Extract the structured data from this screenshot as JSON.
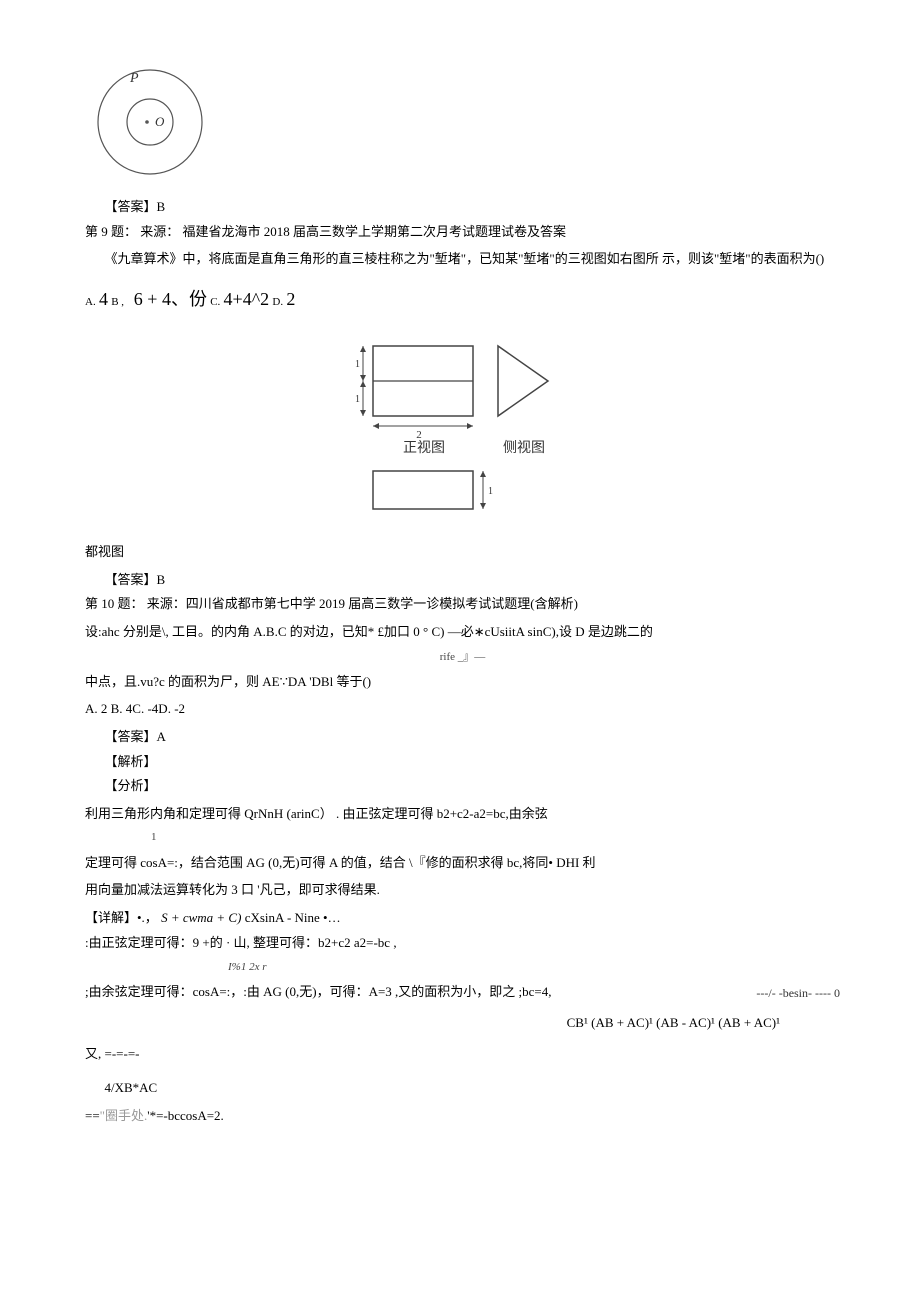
{
  "circle_label_p": "P",
  "circle_label_o": "O",
  "ans8": "【答案】B",
  "q9_head": "第 9 题：  来源： 福建省龙海市 2018 届高三数学上学期第二次月考试题理试卷及答案",
  "q9_body": "《九章算术》中，将底面是直角三角形的直三棱柱称之为\"堑堵\"，已知某\"堑堵\"的三视图如右图所 示，则该\"堑堵\"的表面积为()",
  "q9_opts": {
    "a_lbl": "A.",
    "a_val": "4",
    "b_lbl": "B ,",
    "b_val": "6 + 4、份",
    "c_lbl": "C.",
    "c_val": "4+4^2",
    "d_lbl": "D.",
    "d_val": "2"
  },
  "view_front": "正视图",
  "view_side": "侧视图",
  "view_num_1": "1",
  "view_num_2": "2",
  "view_top_caption": "都视图",
  "ans9": "【答案】B",
  "q10_head": "第 10 题： 来源：四川省成都市第七中学 2019 届高三数学一诊模拟考试试题理(含解析)",
  "q10_line1": "设:ahc 分别是\\, 工目。的内角 A.B.C 的对边，已知* £加口 0 ° C) —必∗cUsiitA sinC),设 D 是边跳二的",
  "q10_mid": "rife _』—",
  "q10_line2": "中点，且.vu?c 的面积为尸，则 AE∵DA 'DBl 等于()",
  "q10_opts": "A. 2 B. 4C. -4D. -2",
  "ans10": "【答案】A",
  "jiexi": "【解析】",
  "fenxi": "【分析】",
  "p1": "利用三角形内角和定理可得 QrNnH (arinC） . 由正弦定理可得 b2+c2-a2=bc,由余弦",
  "p1_sub": "1",
  "p2": "定理可得 cosA=:，结合范围 AG (0,无)可得 A 的值，结合 \\『修的面积求得 bc,将同• DHI 利",
  "p3": "用向量加减法运算转化为 3 口 '凡己，即可求得结果.",
  "p4_a": "【详解】•.，",
  "p4_b_ital": "S + cwma + C)",
  "p4_c": "cXsinA - Nine •…",
  "p5": ":由正弦定理可得：9 +的 · 山, 整理可得：b2+c2 a2=-bc ,",
  "p5_sub": "I%1 2x r",
  "side_note": "---/- -besin- ---- 0",
  "p6": ";由余弦定理可得：cosA=:，:由 AG (0,无)，可得：A=3 ,又的面积为小，即之 ;bc=4,",
  "p7": "CB¹ (AB + AC)¹ (AB - AC)¹ (AB + AC)¹",
  "p8": "又, =-=-=-",
  "p9": "4/XB*AC",
  "p10_a": "==",
  "p10_gray": "\"圈手处.",
  "p10_b": "'*=-bccosA=2."
}
